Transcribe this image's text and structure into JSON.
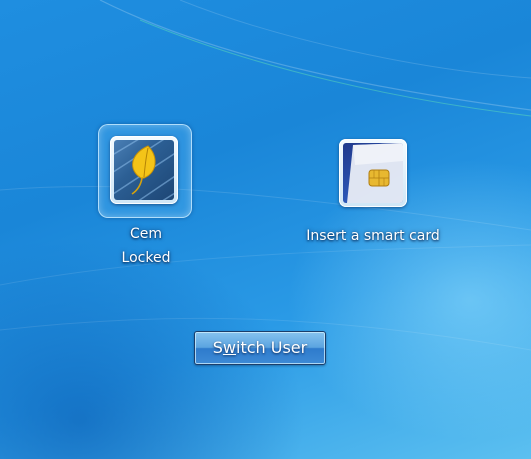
{
  "user_tile": {
    "name": "Cem",
    "status": "Locked",
    "picture": "yellow-leaf-on-blue-planks"
  },
  "smartcard_tile": {
    "label": "Insert a smart card",
    "picture": "smart-card-icon"
  },
  "switch_button": {
    "label_before": "S",
    "label_accel": "w",
    "label_after": "itch User"
  },
  "colors": {
    "background": "#1b86d6",
    "button": "#3d8ad6",
    "text": "#ffffff"
  }
}
